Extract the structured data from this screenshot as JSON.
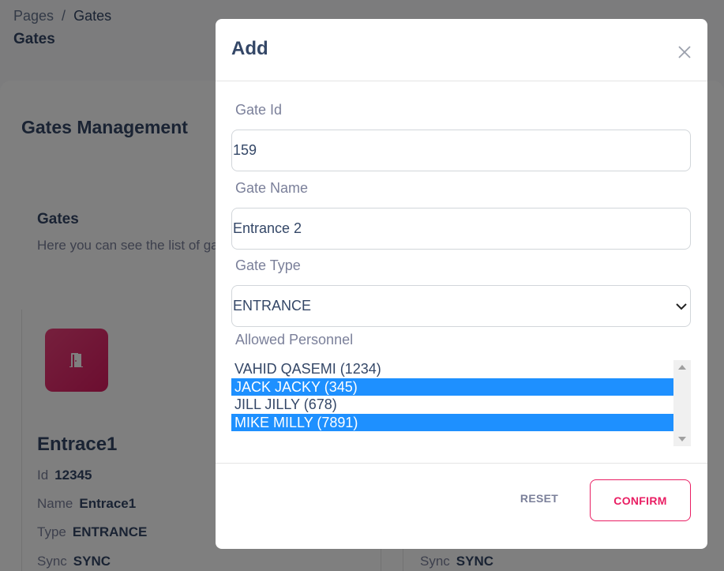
{
  "breadcrumb": {
    "root": "Pages",
    "separator": "/",
    "current": "Gates"
  },
  "page_title": "Gates",
  "management_title": "Gates Management",
  "section": {
    "title": "Gates",
    "description": "Here you can see the list of ga"
  },
  "gate_card": {
    "icon": "door-icon",
    "name": "Entrace1",
    "id_label": "Id",
    "id_value": "12345",
    "name_label": "Name",
    "name_value": "Entrace1",
    "type_label": "Type",
    "type_value": "ENTRANCE",
    "sync_label": "Sync",
    "sync_value": "SYNC"
  },
  "gate_card_2": {
    "sync_label": "Sync",
    "sync_value": "SYNC"
  },
  "modal": {
    "title": "Add",
    "close_icon": "close-icon",
    "gate_id": {
      "label": "Gate Id",
      "value": "159"
    },
    "gate_name": {
      "label": "Gate Name",
      "value": "Entrance 2"
    },
    "gate_type": {
      "label": "Gate Type",
      "value": "ENTRANCE"
    },
    "allowed_personnel": {
      "label": "Allowed Personnel",
      "options": [
        {
          "text": "VAHID QASEMI (1234)",
          "selected": false
        },
        {
          "text": "JACK JACKY (345)",
          "selected": true
        },
        {
          "text": "JILL JILLY (678)",
          "selected": false
        },
        {
          "text": "MIKE MILLY (7891)",
          "selected": true
        }
      ]
    },
    "reset_label": "RESET",
    "confirm_label": "CONFIRM"
  },
  "colors": {
    "accent": "#e91e63",
    "selection": "#1e90ff",
    "overlay": "rgba(0,0,0,0.5)"
  }
}
